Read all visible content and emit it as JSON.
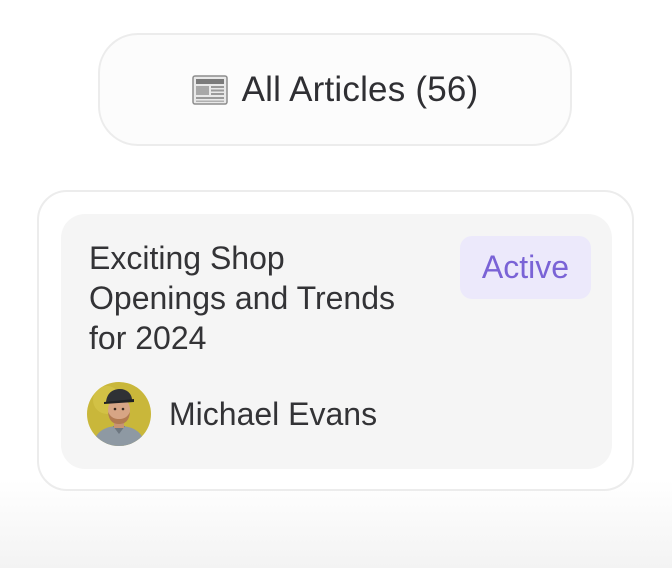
{
  "filter": {
    "icon": "newspaper-icon",
    "label": "All Articles (56)"
  },
  "article": {
    "title": " Exciting Shop\nOpenings and Trends\nfor 2024",
    "status": "Active",
    "author": {
      "name": "Michael Evans",
      "avatar_icon": "avatar"
    }
  },
  "colors": {
    "badge_bg": "#ece9fb",
    "badge_text": "#7a63d6",
    "card_bg": "#f5f5f5",
    "border": "#ececec"
  }
}
